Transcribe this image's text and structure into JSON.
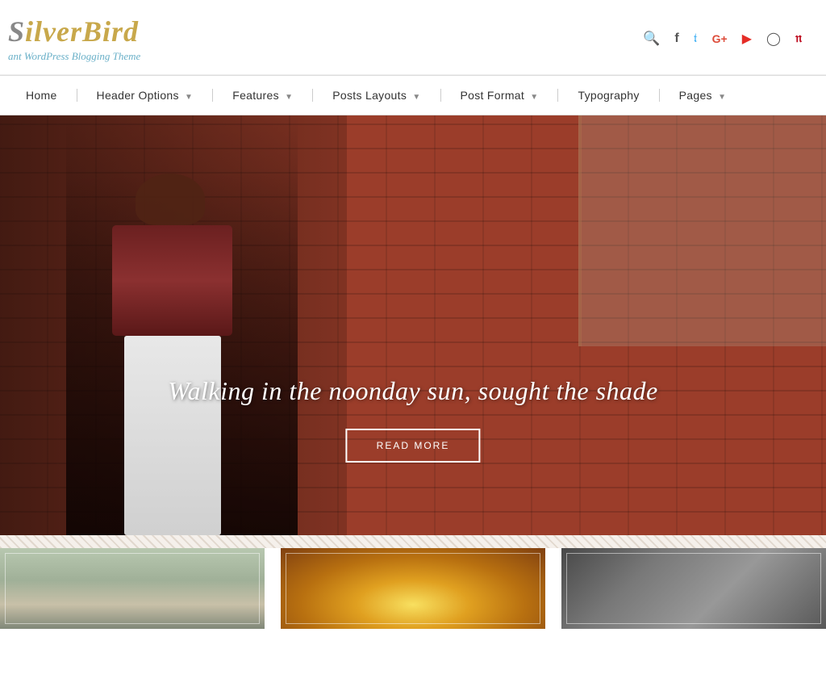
{
  "brand": {
    "title_part1": "ilverBird",
    "title_prefix": "S",
    "tagline": "ant WordPress Blogging Theme"
  },
  "header": {
    "icons": [
      {
        "name": "search-icon",
        "symbol": "🔍",
        "class": "search"
      },
      {
        "name": "facebook-icon",
        "symbol": "f",
        "class": "facebook"
      },
      {
        "name": "twitter-icon",
        "symbol": "𝕥",
        "class": "twitter"
      },
      {
        "name": "google-icon",
        "symbol": "G+",
        "class": "google"
      },
      {
        "name": "youtube-icon",
        "symbol": "▶",
        "class": "youtube"
      },
      {
        "name": "instagram-icon",
        "symbol": "📷",
        "class": "instagram"
      },
      {
        "name": "pinterest-icon",
        "symbol": "𝕡",
        "class": "pinterest"
      }
    ]
  },
  "nav": {
    "items": [
      {
        "label": "Home",
        "has_dropdown": false
      },
      {
        "label": "Header Options",
        "has_dropdown": true
      },
      {
        "label": "Features",
        "has_dropdown": true
      },
      {
        "label": "Posts Layouts",
        "has_dropdown": true
      },
      {
        "label": "Post Format",
        "has_dropdown": true
      },
      {
        "label": "Typography",
        "has_dropdown": false
      },
      {
        "label": "Pages",
        "has_dropdown": true
      }
    ]
  },
  "hero": {
    "title": "Walking in the noonday sun, sought the shade",
    "button_label": "READ MORE"
  },
  "posts": [
    {
      "id": 1,
      "class": "post-thumb-1"
    },
    {
      "id": 2,
      "class": "post-thumb-2"
    },
    {
      "id": 3,
      "class": "post-thumb-3"
    }
  ]
}
